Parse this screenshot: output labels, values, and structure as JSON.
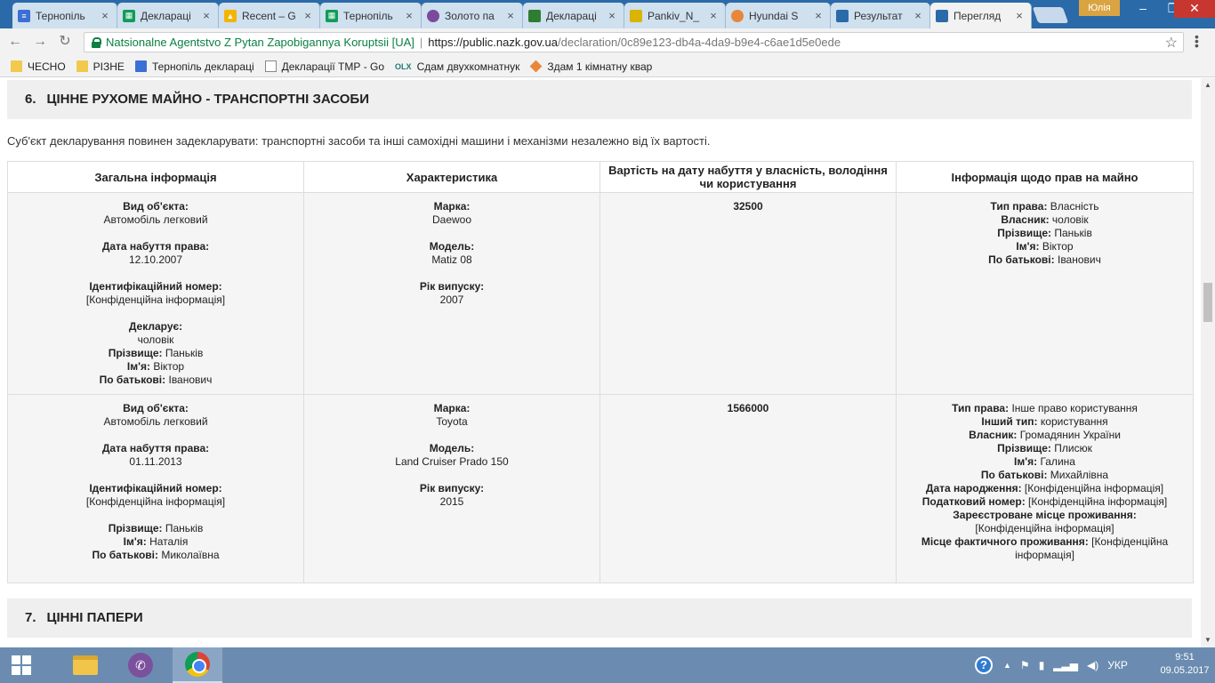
{
  "browser": {
    "tabs": [
      {
        "label": "Тернопіль",
        "icon": "docs-icon",
        "color": "#3b6fd4"
      },
      {
        "label": "Деклараці",
        "icon": "sheets-icon",
        "color": "#0f9d58"
      },
      {
        "label": "Recent – G",
        "icon": "drive-icon",
        "color": "#f4b400"
      },
      {
        "label": "Тернопіль",
        "icon": "sheets-icon",
        "color": "#0f9d58"
      },
      {
        "label": "Золото па",
        "icon": "gold-icon",
        "color": "#7b4a9d"
      },
      {
        "label": "Деклараці",
        "icon": "shield-icon",
        "color": "#2e7d32"
      },
      {
        "label": "Pankiv_N_",
        "icon": "emblem-icon",
        "color": "#d9b400"
      },
      {
        "label": "Hyundai S",
        "icon": "olx-icon",
        "color": "#e8873a"
      },
      {
        "label": "Результат",
        "icon": "nazk-icon",
        "color": "#2b6aa8"
      },
      {
        "label": "Перегляд",
        "icon": "nazk-icon",
        "color": "#2b6aa8"
      }
    ],
    "user": "Юлія",
    "site_name": "Natsionalne Agentstvo Z Pytan Zapobigannya Koruptsii [UA]",
    "url_host": "https://public.nazk.gov.ua",
    "url_path": "/declaration/0c89e123-db4a-4da9-b9e4-c6ae1d5e0ede",
    "bookmarks": [
      {
        "label": "ЧЕСНО",
        "icon": "folder-icon"
      },
      {
        "label": "РІЗНЕ",
        "icon": "folder-icon"
      },
      {
        "label": "Тернопіль деклараці",
        "icon": "docs-icon"
      },
      {
        "label": "Декларації ТМР - Go",
        "icon": "page-icon"
      },
      {
        "label": "Сдам двухкомнатнук",
        "icon": "olx-icon"
      },
      {
        "label": "Здам 1 кімнатну квар",
        "icon": "diamond-icon"
      }
    ]
  },
  "section6": {
    "number": "6.",
    "title": "ЦІННЕ РУХОМЕ МАЙНО - ТРАНСПОРТНІ ЗАСОБИ",
    "intro": "Суб'єкт декларування повинен задекларувати: транспортні засоби та інші самохідні машини і механізми незалежно від їх вартості.",
    "headers": [
      "Загальна інформація",
      "Характеристика",
      "Вартість на дату набуття у власність, володіння чи користування",
      "Інформація щодо прав на майно"
    ],
    "rows": [
      {
        "general": {
          "type_label": "Вид об'єкта:",
          "type_value": "Автомобіль легковий",
          "date_label": "Дата набуття права:",
          "date_value": "12.10.2007",
          "id_label": "Ідентифікаційний номер:",
          "id_value": "[Конфіденційна інформація]",
          "declarant_label": "Декларує:",
          "declarant_value": "чоловік",
          "surname_label": "Прізвище:",
          "surname_value": "Паньків",
          "name_label": "Ім'я:",
          "name_value": "Віктор",
          "patronymic_label": "По батькові:",
          "patronymic_value": "Іванович"
        },
        "spec": {
          "brand_label": "Марка:",
          "brand_value": "Daewoo",
          "model_label": "Модель:",
          "model_value": "Matiz 08",
          "year_label": "Рік випуску:",
          "year_value": "2007"
        },
        "price": "32500",
        "rights": {
          "right_type_label": "Тип права:",
          "right_type_value": "Власність",
          "owner_label": "Власник:",
          "owner_value": "чоловік",
          "surname_label": "Прізвище:",
          "surname_value": "Паньків",
          "name_label": "Ім'я:",
          "name_value": "Віктор",
          "patronymic_label": "По батькові:",
          "patronymic_value": "Іванович"
        }
      },
      {
        "general": {
          "type_label": "Вид об'єкта:",
          "type_value": "Автомобіль легковий",
          "date_label": "Дата набуття права:",
          "date_value": "01.11.2013",
          "id_label": "Ідентифікаційний номер:",
          "id_value": "[Конфіденційна інформація]",
          "surname_label": "Прізвище:",
          "surname_value": "Паньків",
          "name_label": "Ім'я:",
          "name_value": "Наталія",
          "patronymic_label": "По батькові:",
          "patronymic_value": "Миколаївна"
        },
        "spec": {
          "brand_label": "Марка:",
          "brand_value": "Toyota",
          "model_label": "Модель:",
          "model_value": "Land Cruiser Prado 150",
          "year_label": "Рік випуску:",
          "year_value": "2015"
        },
        "price": "1566000",
        "rights": {
          "right_type_label": "Тип права:",
          "right_type_value": "Інше право користування",
          "other_type_label": "Інший тип:",
          "other_type_value": "користування",
          "owner_label": "Власник:",
          "owner_value": "Громадянин України",
          "surname_label": "Прізвище:",
          "surname_value": "Плисюк",
          "name_label": "Ім'я:",
          "name_value": "Галина",
          "patronymic_label": "По батькові:",
          "patronymic_value": "Михайлівна",
          "birth_label": "Дата народження:",
          "birth_value": "[Конфіденційна інформація]",
          "tax_label": "Податковий номер:",
          "tax_value": "[Конфіденційна інформація]",
          "reg_label": "Зареєстроване місце проживання:",
          "reg_value": "[Конфіденційна інформація]",
          "actual_label": "Місце фактичного проживання:",
          "actual_value": "[Конфіденційна інформація]"
        }
      }
    ]
  },
  "section7": {
    "number": "7.",
    "title": "ЦІННІ ПАПЕРИ"
  },
  "taskbar": {
    "language": "УКР",
    "time": "9:51",
    "date": "09.05.2017"
  }
}
